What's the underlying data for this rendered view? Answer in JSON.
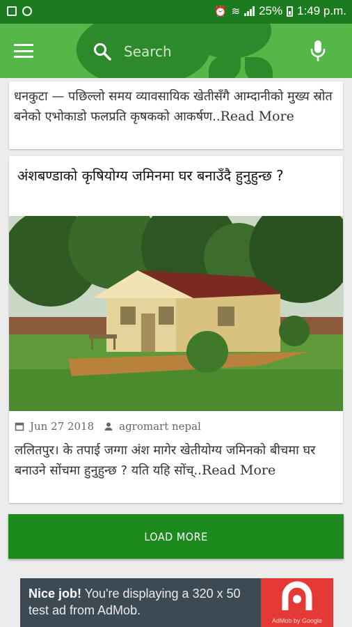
{
  "status_bar": {
    "battery": "25%",
    "time": "1:49 p.m."
  },
  "app_bar": {
    "search_placeholder": "Search",
    "colors": {
      "status": "#1c7a1f",
      "bar": "#53b847"
    }
  },
  "articles": [
    {
      "excerpt": "धनकुटा — पछिल्लो समय व्यावसायिक खेतीसँगै आम्दानीको मुख्य स्रोत बनेको एभोकाडो फलप्रति कृषकको आकर्षण..",
      "read_more": "Read More"
    },
    {
      "title": "अंशबण्डाको कृषियोग्य जमिनमा घर बनाउँदै हुनुहुन्छ ?",
      "date": "Jun 27 2018",
      "author": "agromart nepal",
      "excerpt": "ललितपुर।  के तपाई जग्गा अंश मागेर खेतीयोग्य जमिनको बीचमा घर बनाउने सोंचमा हुनुहुन्छ ? यति यहि सोंच्..",
      "read_more": "Read More"
    }
  ],
  "load_more_label": "LOAD MORE",
  "ad": {
    "bold": "Nice job!",
    "text": " You're displaying a 320 x 50 test ad from AdMob.",
    "logo_caption": "AdMob by Google"
  }
}
